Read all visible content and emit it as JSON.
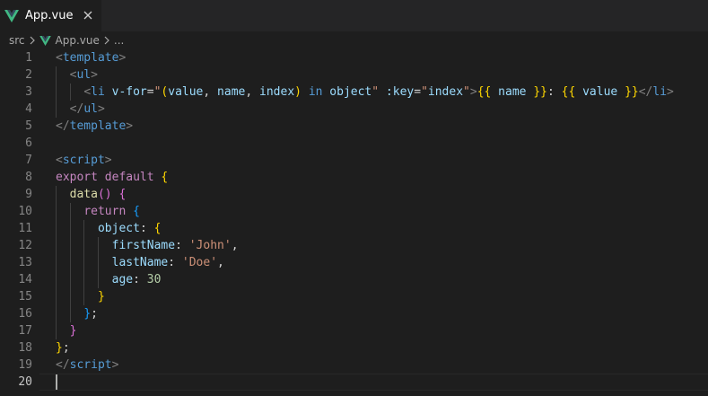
{
  "tab": {
    "label": "App.vue",
    "icon": "vue-icon",
    "close_icon": "close-icon"
  },
  "breadcrumb": {
    "folder": "src",
    "file": "App.vue",
    "trail": "..."
  },
  "editor": {
    "current_line": 20,
    "lines": [
      {
        "n": "1",
        "tokens": [
          [
            "tk-punc",
            "<"
          ],
          [
            "tk-tag",
            "template"
          ],
          [
            "tk-punc",
            ">"
          ]
        ]
      },
      {
        "n": "2",
        "tokens": [
          [
            "tk-txt",
            "  "
          ],
          [
            "tk-punc",
            "<"
          ],
          [
            "tk-tag",
            "ul"
          ],
          [
            "tk-punc",
            ">"
          ]
        ]
      },
      {
        "n": "3",
        "tokens": [
          [
            "tk-txt",
            "    "
          ],
          [
            "tk-punc",
            "<"
          ],
          [
            "tk-tag",
            "li"
          ],
          [
            "tk-txt",
            " "
          ],
          [
            "tk-attr",
            "v-for"
          ],
          [
            "tk-eq",
            "="
          ],
          [
            "tk-str",
            "\""
          ],
          [
            "tk-b1",
            "("
          ],
          [
            "tk-attr",
            "value"
          ],
          [
            "tk-txt",
            ", "
          ],
          [
            "tk-attr",
            "name"
          ],
          [
            "tk-txt",
            ", "
          ],
          [
            "tk-attr",
            "index"
          ],
          [
            "tk-b1",
            ")"
          ],
          [
            "tk-txt",
            " "
          ],
          [
            "tk-opkw",
            "in"
          ],
          [
            "tk-txt",
            " "
          ],
          [
            "tk-attr",
            "object"
          ],
          [
            "tk-str",
            "\""
          ],
          [
            "tk-txt",
            " "
          ],
          [
            "tk-attr",
            ":key"
          ],
          [
            "tk-eq",
            "="
          ],
          [
            "tk-str",
            "\""
          ],
          [
            "tk-attr",
            "index"
          ],
          [
            "tk-str",
            "\""
          ],
          [
            "tk-punc",
            ">"
          ],
          [
            "tk-b1",
            "{{"
          ],
          [
            "tk-txt",
            " "
          ],
          [
            "tk-attr",
            "name"
          ],
          [
            "tk-txt",
            " "
          ],
          [
            "tk-b1",
            "}}"
          ],
          [
            "tk-txt",
            ": "
          ],
          [
            "tk-b1",
            "{{"
          ],
          [
            "tk-txt",
            " "
          ],
          [
            "tk-attr",
            "value"
          ],
          [
            "tk-txt",
            " "
          ],
          [
            "tk-b1",
            "}}"
          ],
          [
            "tk-punc",
            "</"
          ],
          [
            "tk-tag",
            "li"
          ],
          [
            "tk-punc",
            ">"
          ]
        ]
      },
      {
        "n": "4",
        "tokens": [
          [
            "tk-txt",
            "  "
          ],
          [
            "tk-punc",
            "</"
          ],
          [
            "tk-tag",
            "ul"
          ],
          [
            "tk-punc",
            ">"
          ]
        ]
      },
      {
        "n": "5",
        "tokens": [
          [
            "tk-punc",
            "</"
          ],
          [
            "tk-tag",
            "template"
          ],
          [
            "tk-punc",
            ">"
          ]
        ]
      },
      {
        "n": "6",
        "tokens": []
      },
      {
        "n": "7",
        "tokens": [
          [
            "tk-punc",
            "<"
          ],
          [
            "tk-tag",
            "script"
          ],
          [
            "tk-punc",
            ">"
          ]
        ]
      },
      {
        "n": "8",
        "tokens": [
          [
            "tk-kw",
            "export"
          ],
          [
            "tk-txt",
            " "
          ],
          [
            "tk-kw",
            "default"
          ],
          [
            "tk-txt",
            " "
          ],
          [
            "tk-b1",
            "{"
          ]
        ]
      },
      {
        "n": "9",
        "tokens": [
          [
            "tk-txt",
            "  "
          ],
          [
            "tk-fn",
            "data"
          ],
          [
            "tk-b2",
            "()"
          ],
          [
            "tk-txt",
            " "
          ],
          [
            "tk-b2",
            "{"
          ]
        ]
      },
      {
        "n": "10",
        "tokens": [
          [
            "tk-txt",
            "    "
          ],
          [
            "tk-kw",
            "return"
          ],
          [
            "tk-txt",
            " "
          ],
          [
            "tk-b3",
            "{"
          ]
        ]
      },
      {
        "n": "11",
        "tokens": [
          [
            "tk-txt",
            "      "
          ],
          [
            "tk-attr",
            "object"
          ],
          [
            "tk-txt",
            ": "
          ],
          [
            "tk-b1",
            "{"
          ]
        ]
      },
      {
        "n": "12",
        "tokens": [
          [
            "tk-txt",
            "        "
          ],
          [
            "tk-attr",
            "firstName"
          ],
          [
            "tk-txt",
            ": "
          ],
          [
            "tk-str",
            "'John'"
          ],
          [
            "tk-txt",
            ","
          ]
        ]
      },
      {
        "n": "13",
        "tokens": [
          [
            "tk-txt",
            "        "
          ],
          [
            "tk-attr",
            "lastName"
          ],
          [
            "tk-txt",
            ": "
          ],
          [
            "tk-str",
            "'Doe'"
          ],
          [
            "tk-txt",
            ","
          ]
        ]
      },
      {
        "n": "14",
        "tokens": [
          [
            "tk-txt",
            "        "
          ],
          [
            "tk-attr",
            "age"
          ],
          [
            "tk-txt",
            ": "
          ],
          [
            "tk-num",
            "30"
          ]
        ]
      },
      {
        "n": "15",
        "tokens": [
          [
            "tk-txt",
            "      "
          ],
          [
            "tk-b1",
            "}"
          ]
        ]
      },
      {
        "n": "16",
        "tokens": [
          [
            "tk-txt",
            "    "
          ],
          [
            "tk-b3",
            "}"
          ],
          [
            "tk-txt",
            ";"
          ]
        ]
      },
      {
        "n": "17",
        "tokens": [
          [
            "tk-txt",
            "  "
          ],
          [
            "tk-b2",
            "}"
          ]
        ]
      },
      {
        "n": "18",
        "tokens": [
          [
            "tk-b1",
            "}"
          ],
          [
            "tk-txt",
            ";"
          ]
        ]
      },
      {
        "n": "19",
        "tokens": [
          [
            "tk-punc",
            "</"
          ],
          [
            "tk-tag",
            "script"
          ],
          [
            "tk-punc",
            ">"
          ]
        ]
      },
      {
        "n": "20",
        "tokens": []
      }
    ]
  }
}
